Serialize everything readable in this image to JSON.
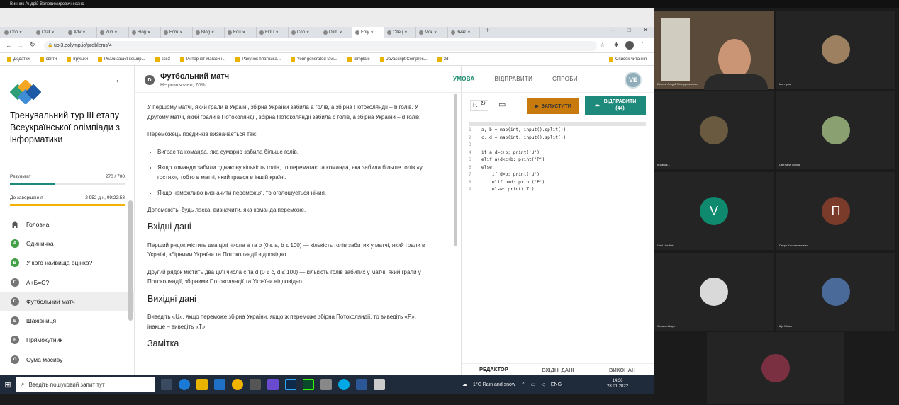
{
  "zoom": {
    "top_label": "Винник Андрій Володимирович сеанс"
  },
  "browser": {
    "tabs": [
      "Con",
      "Craf",
      "Adv",
      "Zub",
      "Blog",
      "Foru",
      "Blog",
      "Edu",
      "EDU",
      "Con",
      "Olim",
      "Eoly",
      "Спец",
      "Мок",
      "Знає"
    ],
    "active_tab": 11,
    "url": "uoi3.eolymp.io/problems/4",
    "bookmarks": [
      "Додатки",
      "свіїти",
      "Ігрушки",
      "Реализация кешир...",
      "ccs3",
      "Интернет-магазин...",
      "Рахунок платника...",
      "Your generated favi...",
      "template",
      "Javascript Compres...",
      "3d",
      "Список читання"
    ]
  },
  "sidebar": {
    "title": "Тренувальний тур ІІІ етапу Всеукраїнської олімпіади з інформатики",
    "result_label": "Результат",
    "result_value": "270 / 700",
    "result_fraction": 0.386,
    "deadline_label": "До завершення",
    "deadline_value": "2 952 дні, 09:22:58",
    "home": "Головна",
    "problems": [
      {
        "letter": "A",
        "name": "Одиничка",
        "solved": true
      },
      {
        "letter": "B",
        "name": "У кого найвища оцінка?",
        "solved": true
      },
      {
        "letter": "C",
        "name": "A+Б=С?",
        "solved": false
      },
      {
        "letter": "D",
        "name": "Футбольний матч",
        "solved": false,
        "active": true
      },
      {
        "letter": "E",
        "name": "Шахівниця",
        "solved": false
      },
      {
        "letter": "F",
        "name": "Прямокутник",
        "solved": false
      },
      {
        "letter": "G",
        "name": "Сума масиву",
        "solved": false
      }
    ]
  },
  "problem": {
    "letter": "D",
    "title": "Футбольний матч",
    "status": "Не розв'язано, 70%",
    "p1": "У першому матчі, який грали в Україні, збірна України забила a голів, а збірна Потоколяндії – b голів. У другому матчі, який грали в Потоколяндії, збірна Потоколяндії забила c голів, а збірна України – d голів.",
    "p2": "Переможець поєдинків визначається так:",
    "rules": [
      "Виграє та команда, яка сумарно забила більше голів.",
      "Якщо команди забили однакову кількість голів, то перемагає та команда, яка забила більше голів «у гостях», тобто в матчі, який грався в іншій країні.",
      "Якщо неможливо визначити переможця, то оголошується нічия."
    ],
    "p3": "Допоможіть, будь ласка, визначити, яка команда переможе.",
    "input_title": "Вхідні дані",
    "input_p1": "Перший рядок містить два цілі числа a та b (0 ≤ a, b ≤ 100) — кількість голів забитих у матчі, який грали в Україні, збірними України та Потоколяндії відповідно.",
    "input_p2": "Другий рядок містить два цілі числа c та d (0 ≤ c, d ≤ 100) — кількість голів забитих у матчі, який грали у Потоколяндії, збірними Потоколяндії та України відповідно.",
    "output_title": "Вихідні дані",
    "output_p": "Виведіть «U», якщо переможе збірна України, якщо ж переможе збірна Потоколяндії, то виведіть «P», інакше – виведіть «T».",
    "note_title": "Замітка"
  },
  "right": {
    "tabs": [
      "УМОВА",
      "ВІДПРАВИТИ",
      "СПРОБИ"
    ],
    "avatar": "VE",
    "lang": "P.",
    "run": "ЗАПУСТИТИ",
    "submit": "ВІДПРАВИТИ",
    "submit_count": "(44)",
    "code": [
      "a, b = map(int, input().split())",
      "c, d = map(int, input().split())",
      "",
      "if a+d>c+b: print('U')",
      "elif a+d<c+b: print('P')",
      "else:",
      "    if d>b: print('U')",
      "    elif b>d: print('P')",
      "    else: print('T')"
    ],
    "editor_tabs": [
      "РЕДАКТОР",
      "ВХІДНІ ДАНІ",
      "ВИКОНАН"
    ]
  },
  "taskbar": {
    "search": "Введіть пошуковий запит тут",
    "weather": "1°C Rain and snow",
    "lang": "ENG",
    "time": "14:36",
    "date": "28.01.2022"
  },
  "participants": [
    {
      "name": "Винник Андрій Володимирович",
      "kind": "video"
    },
    {
      "name": "Іван Іруш",
      "kind": "photo",
      "color": "#9c8060"
    },
    {
      "name": "Кравчук...",
      "kind": "photo",
      "color": "#6a5a40"
    },
    {
      "name": "Світлана Орлик",
      "kind": "photo",
      "color": "#8aa070"
    },
    {
      "name": "Vlad Vasiliuk",
      "kind": "letter",
      "letter": "V",
      "color": "#0f8a6f"
    },
    {
      "name": "Петро Костянтинович",
      "kind": "letter",
      "letter": "П",
      "color": "#7a3b2a"
    },
    {
      "name": "Оксана Шаро",
      "kind": "photo",
      "color": "#d9d9d9"
    },
    {
      "name": "Що Жінки",
      "kind": "photo",
      "color": "#4a6a9a"
    },
    {
      "name": "",
      "kind": "photo",
      "color": "#7a3040"
    }
  ]
}
